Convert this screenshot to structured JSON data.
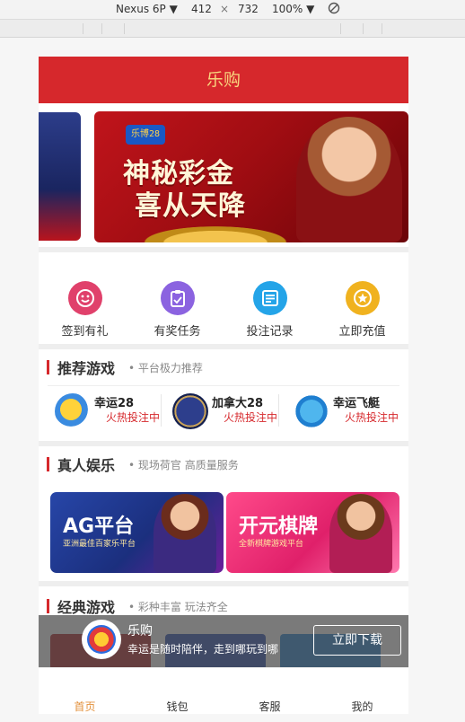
{
  "devtools": {
    "device": "Nexus 6P",
    "width": "412",
    "times": "×",
    "height": "732",
    "zoom": "100%"
  },
  "header": {
    "title": "乐购"
  },
  "banner": {
    "logo": "乐博28",
    "line1": "神秘彩金",
    "line2": "喜从天降"
  },
  "quick_actions": [
    {
      "label": "签到有礼",
      "icon": "smile-icon",
      "color": "#e0416b"
    },
    {
      "label": "有奖任务",
      "icon": "clipboard-icon",
      "color": "#8b63e0"
    },
    {
      "label": "投注记录",
      "icon": "list-icon",
      "color": "#24a4e8"
    },
    {
      "label": "立即充值",
      "icon": "star-icon",
      "color": "#f0b21f"
    }
  ],
  "recommend": {
    "title": "推荐游戏",
    "subtitle": "• 平台极力推荐",
    "games": [
      {
        "name": "幸运28",
        "status": "火热投注中"
      },
      {
        "name": "加拿大28",
        "status": "火热投注中"
      },
      {
        "name": "幸运飞艇",
        "status": "火热投注中"
      }
    ]
  },
  "live": {
    "title": "真人娱乐",
    "subtitle": "• 现场荷官 高质量服务",
    "cards": [
      {
        "title": "AG平台",
        "tagline": "亚洲最佳百家乐平台"
      },
      {
        "title": "开元棋牌",
        "tagline": "全新棋牌游戏平台"
      }
    ]
  },
  "classic": {
    "title": "经典游戏",
    "subtitle": "• 彩种丰富 玩法齐全"
  },
  "download": {
    "name": "乐购",
    "slogan": "幸运是随时陪伴，走到哪玩到哪",
    "button": "立即下载"
  },
  "tabs": [
    {
      "label": "首页",
      "active": true
    },
    {
      "label": "钱包",
      "active": false
    },
    {
      "label": "客服",
      "active": false
    },
    {
      "label": "我的",
      "active": false
    }
  ],
  "colors": {
    "brand": "#d6282c",
    "title_gold": "#f8d57e",
    "active_tab": "#e3913c"
  }
}
